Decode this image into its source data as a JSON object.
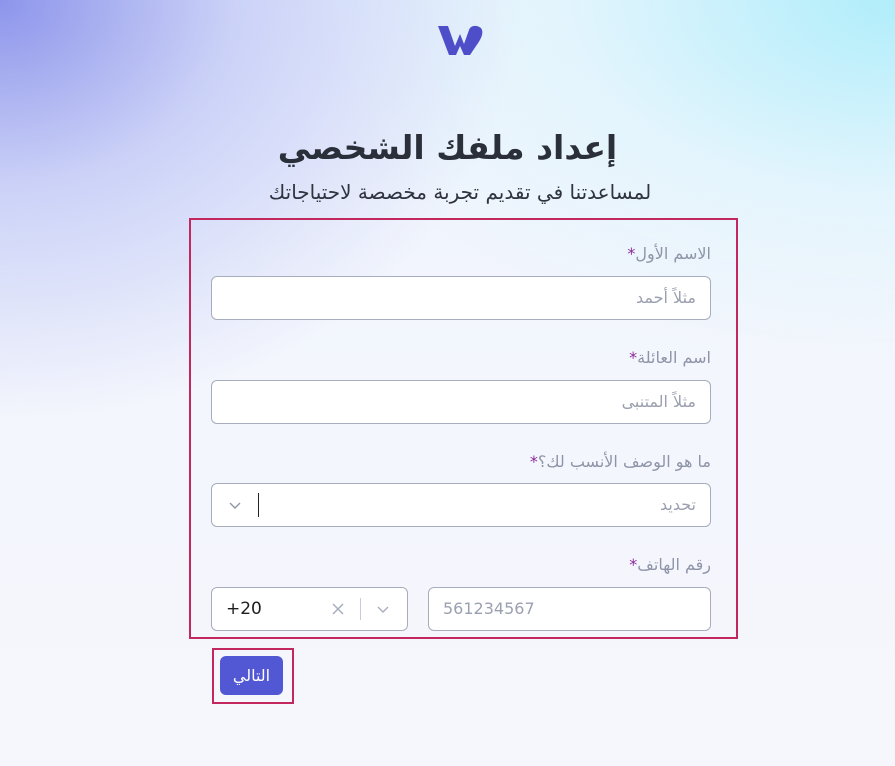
{
  "header": {
    "logo_icon": "w-logo-icon",
    "title": "إعداد ملفك الشخصي",
    "subtitle": "لمساعدتنا في تقديم تجربة مخصصة لاحتياجاتك"
  },
  "form": {
    "first_name": {
      "label": "الاسم الأول",
      "required_mark": "*",
      "placeholder": "مثلاً أحمد"
    },
    "last_name": {
      "label": "اسم العائلة",
      "required_mark": "*",
      "placeholder": "مثلاً المتنبى"
    },
    "description": {
      "label": "ما هو الوصف الأنسب لك؟",
      "required_mark": "*",
      "placeholder": "تحديد",
      "icon": "chevron-down-icon"
    },
    "phone": {
      "label": "رقم الهاتف",
      "required_mark": "*",
      "country_code": "+20",
      "placeholder": "561234567",
      "clear_icon": "close-icon",
      "dropdown_icon": "chevron-down-icon"
    }
  },
  "actions": {
    "next_label": "التالي"
  },
  "colors": {
    "brand": "#5257d4",
    "highlight_border": "#c2275d",
    "required": "#8b2a9a",
    "label": "#8e95a8"
  }
}
